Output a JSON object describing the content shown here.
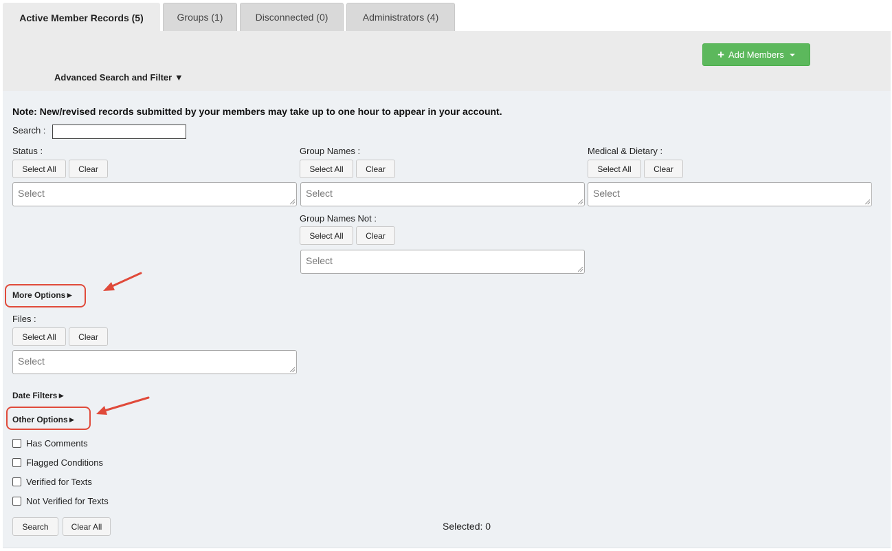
{
  "tabs": [
    {
      "label": "Active Member Records (5)",
      "active": true
    },
    {
      "label": "Groups (1)",
      "active": false
    },
    {
      "label": "Disconnected (0)",
      "active": false
    },
    {
      "label": "Administrators (4)",
      "active": false
    }
  ],
  "topbar": {
    "add_members_label": "Add Members",
    "advanced_search_label": "Advanced Search and Filter ▼"
  },
  "filters": {
    "note": "Note: New/revised records submitted by your members may take up to one hour to appear in your account.",
    "search_label": "Search :",
    "search_value": "",
    "select_all_label": "Select All",
    "clear_label": "Clear",
    "select_placeholder": "Select",
    "status_label": "Status :",
    "group_names_label": "Group Names :",
    "medical_label": "Medical & Dietary :",
    "group_names_not_label": "Group Names Not :",
    "more_options_label": "More Options►",
    "files_label": "Files :",
    "date_filters_label": "Date Filters►",
    "other_options_label": "Other Options►",
    "checkboxes": [
      {
        "label": "Has Comments",
        "checked": false
      },
      {
        "label": "Flagged Conditions",
        "checked": false
      },
      {
        "label": "Verified for Texts",
        "checked": false
      },
      {
        "label": "Not Verified for Texts",
        "checked": false
      }
    ],
    "search_button_label": "Search",
    "clear_all_label": "Clear All",
    "selected_text": "Selected: 0"
  },
  "colors": {
    "add_button": "#5cb85c",
    "annotation": "#e04a3a",
    "panel_bg": "#eef1f4"
  }
}
